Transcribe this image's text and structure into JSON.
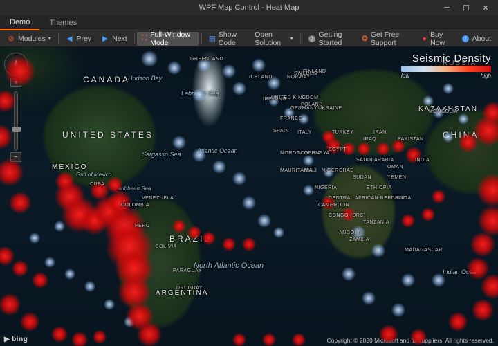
{
  "window": {
    "title": "WPF Map Control - Heat Map"
  },
  "tabs": [
    {
      "label": "Demo",
      "active": true
    },
    {
      "label": "Themes",
      "active": false
    }
  ],
  "toolbar": {
    "modules": "Modules",
    "prev": "Prev",
    "next": "Next",
    "full_window": "Full-Window Mode",
    "show_code": "Show Code",
    "open_solution": "Open Solution",
    "getting_started": "Getting Started",
    "free_support": "Get Free Support",
    "buy_now": "Buy Now",
    "about": "About"
  },
  "legend": {
    "title": "Seismic Density",
    "low": "low",
    "high": "high"
  },
  "map_labels": {
    "countries_large": [
      "CANADA",
      "UNITED STATES",
      "BRAZIL",
      "CHINA",
      "RUSSIA"
    ],
    "countries_mid": [
      "MEXICO",
      "ARGENTINA",
      "KAZAKHSTAN"
    ],
    "countries_small": [
      "GREENLAND",
      "CUBA",
      "VENEZUELA",
      "COLOMBIA",
      "BOLIVIA",
      "PERU",
      "PARAGUAY",
      "URUGUAY",
      "NORWAY",
      "SWEDEN",
      "FINLAND",
      "ICELAND",
      "IRELAND",
      "UNITED KINGDOM",
      "FRANCE",
      "SPAIN",
      "GERMANY",
      "POLAND",
      "UKRAINE",
      "ITALY",
      "TURKEY",
      "IRAN",
      "IRAQ",
      "SAUDI ARABIA",
      "EGYPT",
      "LIBYA",
      "ALGERIA",
      "MOROCCO",
      "MAURITANIA",
      "MALI",
      "NIGER",
      "CHAD",
      "SUDAN",
      "ETHIOPIA",
      "NIGERIA",
      "CAMEROON",
      "ANGOLA",
      "TANZANIA",
      "ZAMBIA",
      "MADAGASCAR",
      "INDIA",
      "PAKISTAN",
      "MONGOLIA",
      "CONGO (DRC)",
      "SOMALIA",
      "YEMEN",
      "OMAN",
      "CENTRAL AFRICAN REPUBLIC"
    ],
    "water": [
      "Hudson Bay",
      "Labrador Sea",
      "Gulf of Mexico",
      "Caribbean Sea",
      "Sargasso Sea",
      "Atlantic Ocean",
      "North Atlantic Ocean",
      "Indian Ocean"
    ]
  },
  "attribution": {
    "provider": "bing",
    "copyright": "Copyright © 2020 Microsoft and its suppliers. All rights reserved."
  },
  "chart_data": {
    "type": "heatmap",
    "title": "Seismic Density",
    "color_scale": {
      "low": "#9cc0e8",
      "high": "#d01010",
      "label_low": "low",
      "label_high": "high"
    },
    "note": "x/y below are percentages of the map viewport (0-100), r is radius in px; heat clusters read off the image",
    "high_density": [
      {
        "x": 4,
        "y": 8,
        "r": 22
      },
      {
        "x": 1,
        "y": 18,
        "r": 16
      },
      {
        "x": 0,
        "y": 30,
        "r": 18
      },
      {
        "x": 2,
        "y": 42,
        "r": 20
      },
      {
        "x": 4,
        "y": 52,
        "r": 16
      },
      {
        "x": 13,
        "y": 45,
        "r": 14
      },
      {
        "x": 14,
        "y": 50,
        "r": 22
      },
      {
        "x": 16,
        "y": 56,
        "r": 26
      },
      {
        "x": 19,
        "y": 58,
        "r": 20
      },
      {
        "x": 22,
        "y": 55,
        "r": 24
      },
      {
        "x": 24,
        "y": 52,
        "r": 18
      },
      {
        "x": 25,
        "y": 60,
        "r": 30
      },
      {
        "x": 26,
        "y": 67,
        "r": 34
      },
      {
        "x": 27,
        "y": 74,
        "r": 28
      },
      {
        "x": 27,
        "y": 82,
        "r": 24
      },
      {
        "x": 28,
        "y": 90,
        "r": 20
      },
      {
        "x": 30,
        "y": 96,
        "r": 18
      },
      {
        "x": 20,
        "y": 48,
        "r": 14
      },
      {
        "x": 23,
        "y": 46,
        "r": 12
      },
      {
        "x": 66,
        "y": 30,
        "r": 10
      },
      {
        "x": 67,
        "y": 33,
        "r": 12
      },
      {
        "x": 70,
        "y": 34,
        "r": 10
      },
      {
        "x": 73,
        "y": 34,
        "r": 10
      },
      {
        "x": 77,
        "y": 34,
        "r": 10
      },
      {
        "x": 80,
        "y": 33,
        "r": 10
      },
      {
        "x": 83,
        "y": 36,
        "r": 12
      },
      {
        "x": 94,
        "y": 32,
        "r": 14
      },
      {
        "x": 98,
        "y": 28,
        "r": 22
      },
      {
        "x": 99,
        "y": 22,
        "r": 16
      },
      {
        "x": 99,
        "y": 48,
        "r": 24
      },
      {
        "x": 99,
        "y": 58,
        "r": 22
      },
      {
        "x": 97,
        "y": 66,
        "r": 18
      },
      {
        "x": 96,
        "y": 74,
        "r": 16
      },
      {
        "x": 99,
        "y": 80,
        "r": 18
      },
      {
        "x": 97,
        "y": 88,
        "r": 16
      },
      {
        "x": 92,
        "y": 92,
        "r": 14
      },
      {
        "x": 1,
        "y": 70,
        "r": 14
      },
      {
        "x": 4,
        "y": 74,
        "r": 12
      },
      {
        "x": 8,
        "y": 78,
        "r": 12
      },
      {
        "x": 2,
        "y": 86,
        "r": 16
      },
      {
        "x": 6,
        "y": 92,
        "r": 14
      },
      {
        "x": 12,
        "y": 96,
        "r": 12
      },
      {
        "x": 16,
        "y": 98,
        "r": 12
      },
      {
        "x": 20,
        "y": 97,
        "r": 10
      },
      {
        "x": 36,
        "y": 60,
        "r": 10
      },
      {
        "x": 39,
        "y": 62,
        "r": 10
      },
      {
        "x": 42,
        "y": 64,
        "r": 10
      },
      {
        "x": 46,
        "y": 66,
        "r": 10
      },
      {
        "x": 50,
        "y": 66,
        "r": 10
      },
      {
        "x": 82,
        "y": 58,
        "r": 10
      },
      {
        "x": 86,
        "y": 56,
        "r": 10
      },
      {
        "x": 88,
        "y": 50,
        "r": 10
      },
      {
        "x": 48,
        "y": 98,
        "r": 10
      },
      {
        "x": 54,
        "y": 98,
        "r": 10
      },
      {
        "x": 60,
        "y": 98,
        "r": 10
      },
      {
        "x": 78,
        "y": 96,
        "r": 14
      },
      {
        "x": 84,
        "y": 97,
        "r": 12
      },
      {
        "x": 66,
        "y": 52,
        "r": 10
      },
      {
        "x": 70,
        "y": 56,
        "r": 10
      }
    ],
    "low_density": [
      {
        "x": 30,
        "y": 4,
        "r": 12
      },
      {
        "x": 35,
        "y": 7,
        "r": 10
      },
      {
        "x": 41,
        "y": 6,
        "r": 10
      },
      {
        "x": 46,
        "y": 8,
        "r": 10
      },
      {
        "x": 52,
        "y": 6,
        "r": 10
      },
      {
        "x": 55,
        "y": 12,
        "r": 10
      },
      {
        "x": 40,
        "y": 16,
        "r": 10
      },
      {
        "x": 48,
        "y": 14,
        "r": 10
      },
      {
        "x": 36,
        "y": 32,
        "r": 10
      },
      {
        "x": 40,
        "y": 36,
        "r": 10
      },
      {
        "x": 44,
        "y": 40,
        "r": 10
      },
      {
        "x": 48,
        "y": 44,
        "r": 10
      },
      {
        "x": 50,
        "y": 52,
        "r": 10
      },
      {
        "x": 53,
        "y": 58,
        "r": 10
      },
      {
        "x": 56,
        "y": 62,
        "r": 8
      },
      {
        "x": 55,
        "y": 18,
        "r": 8
      },
      {
        "x": 58,
        "y": 22,
        "r": 8
      },
      {
        "x": 61,
        "y": 24,
        "r": 8
      },
      {
        "x": 72,
        "y": 62,
        "r": 10
      },
      {
        "x": 76,
        "y": 68,
        "r": 10
      },
      {
        "x": 70,
        "y": 76,
        "r": 10
      },
      {
        "x": 74,
        "y": 84,
        "r": 10
      },
      {
        "x": 80,
        "y": 88,
        "r": 10
      },
      {
        "x": 82,
        "y": 78,
        "r": 10
      },
      {
        "x": 88,
        "y": 78,
        "r": 10
      },
      {
        "x": 86,
        "y": 18,
        "r": 8
      },
      {
        "x": 90,
        "y": 14,
        "r": 8
      },
      {
        "x": 88,
        "y": 22,
        "r": 8
      },
      {
        "x": 93,
        "y": 24,
        "r": 8
      },
      {
        "x": 90,
        "y": 30,
        "r": 8
      },
      {
        "x": 10,
        "y": 72,
        "r": 8
      },
      {
        "x": 14,
        "y": 76,
        "r": 8
      },
      {
        "x": 18,
        "y": 80,
        "r": 8
      },
      {
        "x": 22,
        "y": 86,
        "r": 8
      },
      {
        "x": 26,
        "y": 92,
        "r": 8
      },
      {
        "x": 7,
        "y": 64,
        "r": 8
      },
      {
        "x": 12,
        "y": 60,
        "r": 8
      },
      {
        "x": 62,
        "y": 38,
        "r": 8
      },
      {
        "x": 66,
        "y": 42,
        "r": 8
      },
      {
        "x": 62,
        "y": 48,
        "r": 8
      }
    ]
  }
}
